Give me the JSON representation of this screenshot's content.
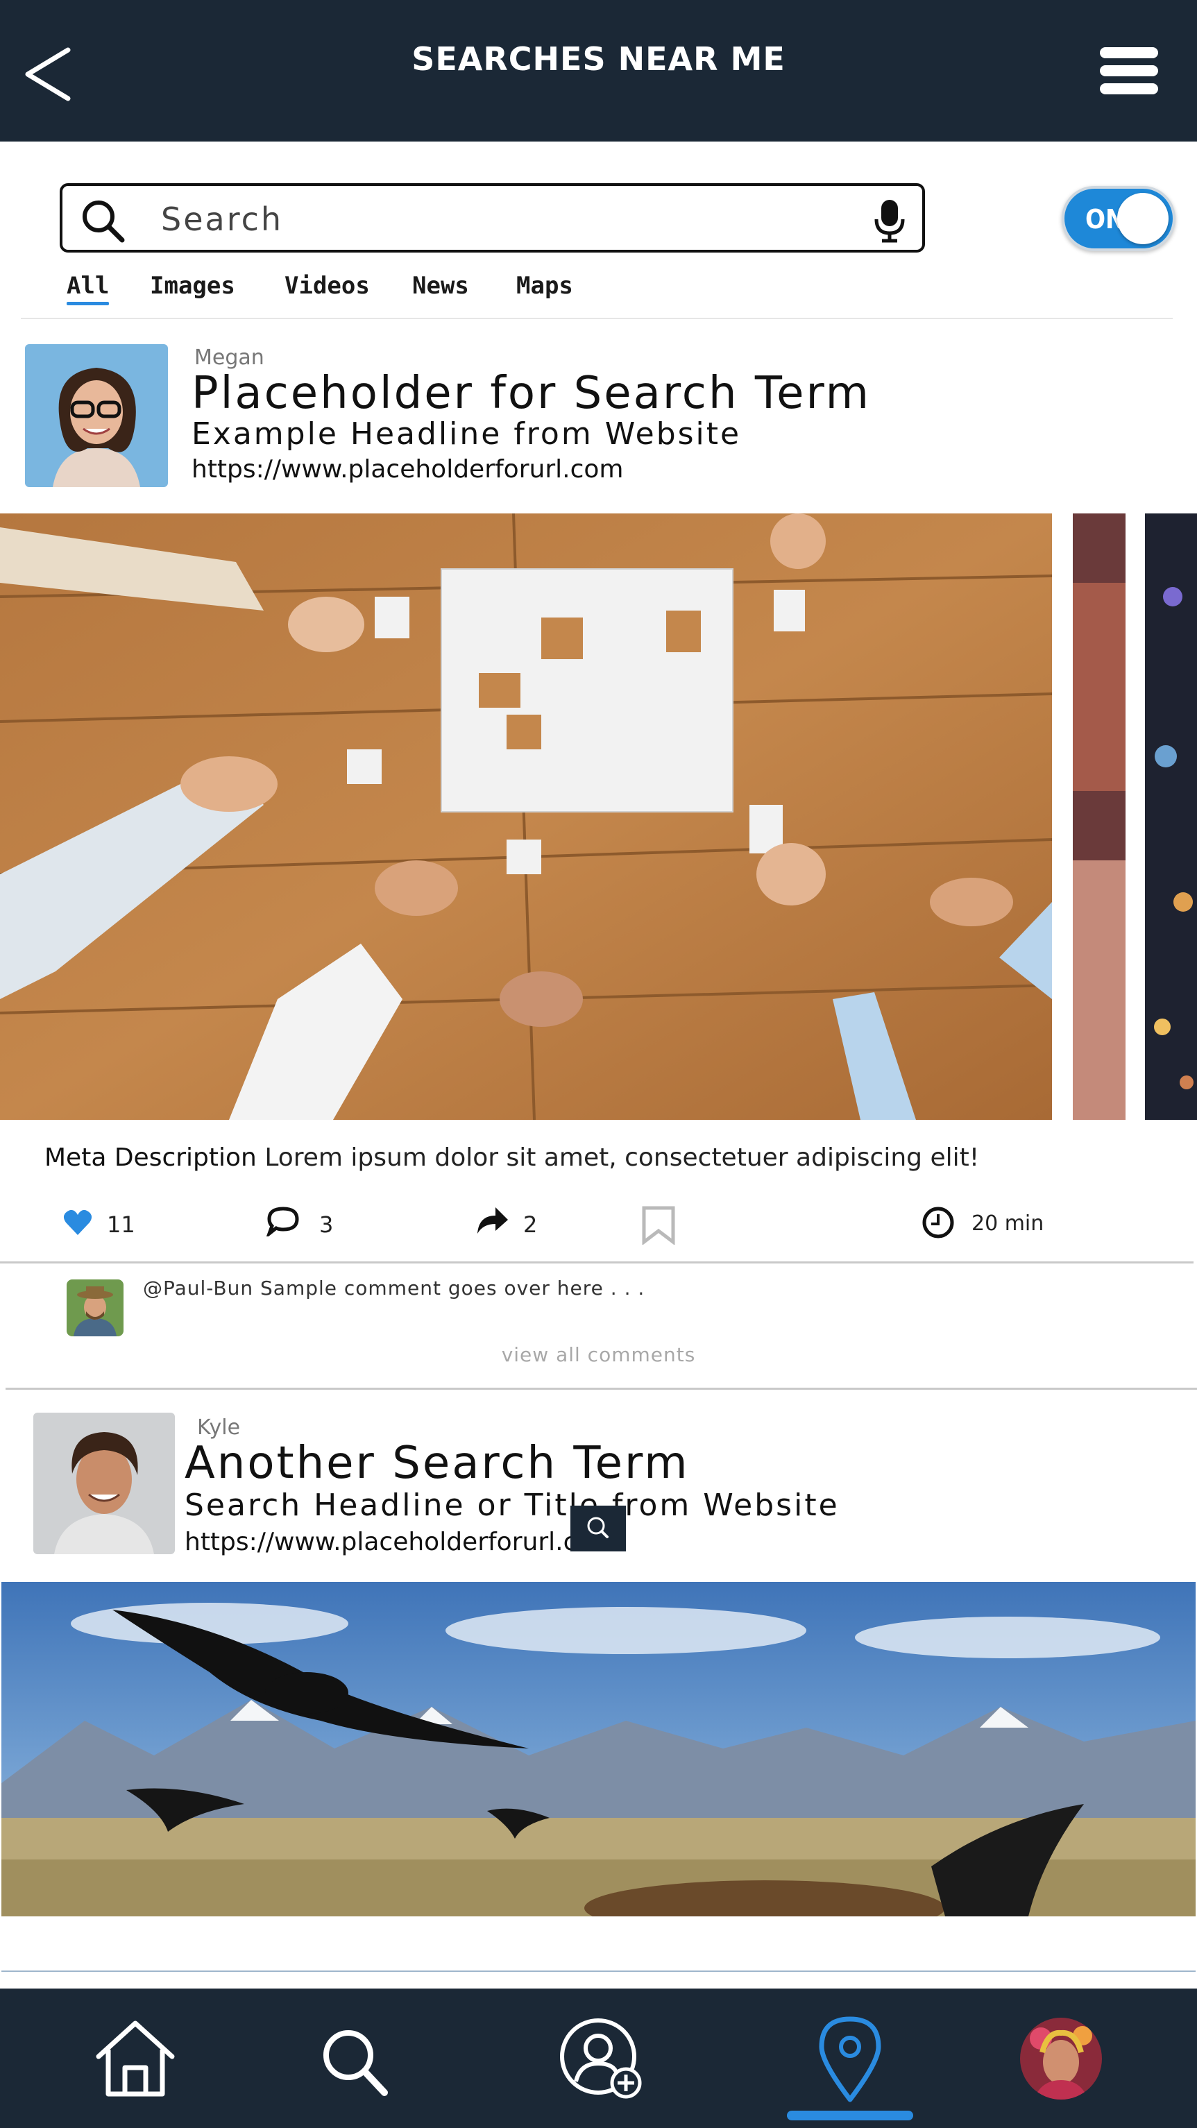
{
  "header": {
    "title": "SEARCHES NEAR ME",
    "back_icon": "chevron-left-icon",
    "menu_icon": "hamburger-menu-icon"
  },
  "search": {
    "placeholder": "Search",
    "icon": "search-icon",
    "voice_icon": "microphone-icon",
    "toggle_label": "ON",
    "toggle_state": true
  },
  "tabs": [
    {
      "label": "All",
      "active": true
    },
    {
      "label": "Images",
      "active": false
    },
    {
      "label": "Videos",
      "active": false
    },
    {
      "label": "News",
      "active": false
    },
    {
      "label": "Maps",
      "active": false
    }
  ],
  "posts": [
    {
      "user": "Megan",
      "title": "Placeholder for Search Term",
      "headline": "Example Headline from Website",
      "url": "https://www.placeholderforurl.com",
      "meta_label": "Meta Description",
      "meta_text": "Lorem ipsum dolor sit amet, consectetuer adipiscing elit!",
      "likes": "11",
      "comments": "3",
      "shares": "2",
      "time": "20 min",
      "comment": {
        "text": "@Paul-Bun Sample comment goes over here . . .",
        "view_all": "view all comments"
      }
    },
    {
      "user": "Kyle",
      "title": "Another Search Term",
      "headline": "Search Headline or Title from Website",
      "url": "https://www.placeholderforurl.c"
    }
  ],
  "bottom_nav": [
    {
      "icon": "home-icon",
      "active": false
    },
    {
      "icon": "search-icon",
      "active": false
    },
    {
      "icon": "add-friend-icon",
      "active": false
    },
    {
      "icon": "location-pin-icon",
      "active": true
    },
    {
      "icon": "profile-avatar-icon",
      "active": false
    }
  ],
  "colors": {
    "header_bg": "#1b2836",
    "accent": "#2a8be0",
    "toggle": "#1e88d8",
    "like_heart": "#2a8be0"
  }
}
